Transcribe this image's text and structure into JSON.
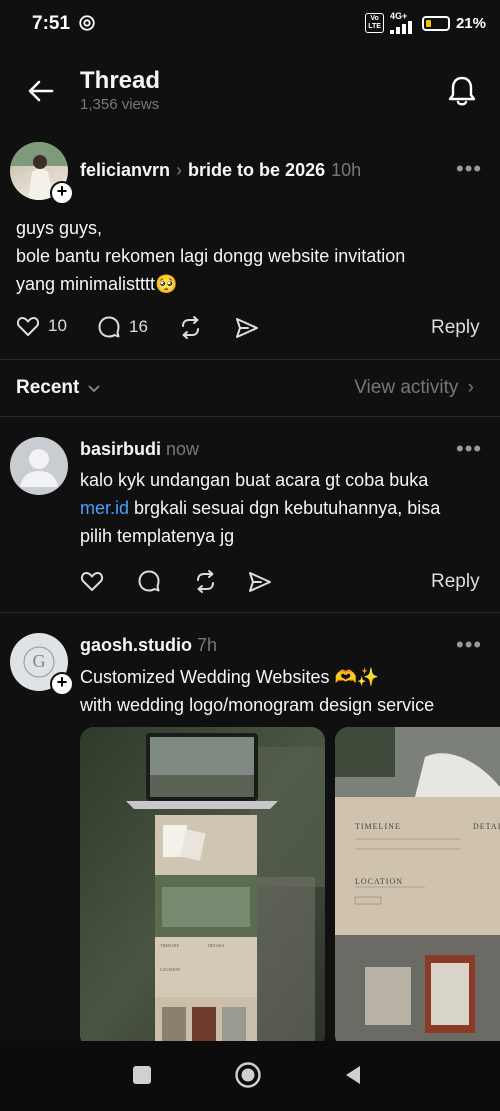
{
  "status_bar": {
    "time": "7:51",
    "network": "4G+",
    "battery": "21%",
    "volte_top": "Vo",
    "volte_bottom": "LTE"
  },
  "header": {
    "title": "Thread",
    "views": "1,356 views"
  },
  "main_post": {
    "username": "felicianvrn",
    "community": "bride to be 2026",
    "time": "10h",
    "text_line1": "guys guys,",
    "text_line2": "bole bantu rekomen lagi dongg website invitation",
    "text_line3": "yang minimalistttt🥺",
    "likes": "10",
    "comments": "16",
    "reply_label": "Reply"
  },
  "recent_row": {
    "label": "Recent",
    "view_activity": "View activity"
  },
  "reply1": {
    "username": "basirbudi",
    "time": "now",
    "text_line1": "kalo kyk undangan buat acara gt coba buka",
    "link": "mer.id",
    "text_line2_rest": " brgkali sesuai dgn kebutuhannya, bisa",
    "text_line3": "pilih templatenya jg",
    "reply_label": "Reply"
  },
  "reply2": {
    "username": "gaosh.studio",
    "time": "7h",
    "text_line1": "Customized Wedding Websites 🫶✨",
    "text_line2": "with wedding logo/monogram design service",
    "avatar_letter": "G",
    "img2_timeline": "TIMELINE",
    "img2_details": "DETAILS",
    "img2_location": "LOCATION",
    "img1_timeline": "TIMELINE",
    "img1_details": "DETAILS",
    "img1_location": "LOCATION"
  },
  "colors": {
    "background": "#101010",
    "text": "#f3f5f7",
    "muted": "#777777",
    "link": "#4a9eff",
    "divider": "#2a2a2a"
  }
}
